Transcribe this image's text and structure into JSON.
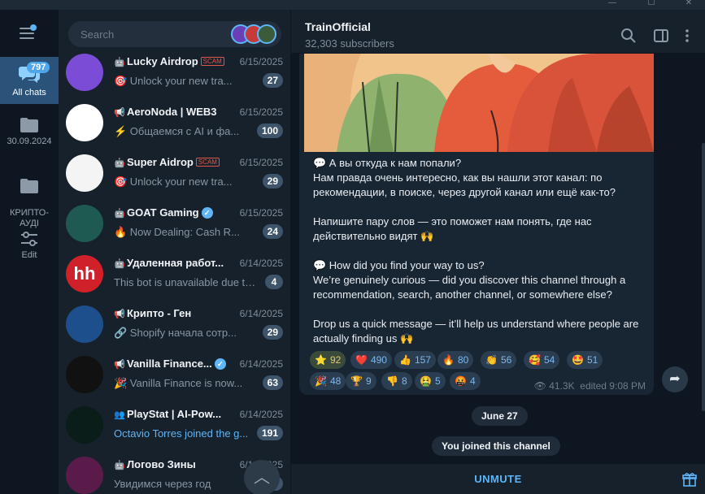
{
  "window": {
    "controls": [
      "—",
      "☐",
      "✕"
    ]
  },
  "folders": {
    "items": [
      {
        "label": "All chats",
        "badge": "797",
        "icon": "chat-bubbles-icon"
      },
      {
        "label": "30.09.2024",
        "icon": "folder-icon"
      },
      {
        "label": "КРИПТО-\nАУДІ",
        "icon": "folder-icon"
      },
      {
        "label": "Edit",
        "icon": "sliders-icon"
      }
    ]
  },
  "search": {
    "placeholder": "Search"
  },
  "chats": [
    {
      "name": "Lucky Airdrop",
      "scam": "SCAM",
      "date": "6/15/2025",
      "preview": "🎯 Unlock your new tra...",
      "count": "27",
      "avatar_color": "#7b4cd6",
      "type": "bot"
    },
    {
      "name": "AeroNoda | WEB3",
      "date": "6/15/2025",
      "preview": "⚡ Общаемся с AI и фа...",
      "count": "100",
      "avatar_color": "#ffffff",
      "type": "channel"
    },
    {
      "name": "Super Aidrop",
      "scam": "SCAM",
      "date": "6/15/2025",
      "preview": "🎯 Unlock your new tra...",
      "count": "29",
      "avatar_color": "#f4f4f4",
      "type": "bot"
    },
    {
      "name": "GOAT Gaming",
      "verified": true,
      "date": "6/15/2025",
      "preview": "🔥 Now Dealing: Cash R...",
      "count": "24",
      "avatar_color": "#1e5a52",
      "type": "bot"
    },
    {
      "name": "Удаленная работ...",
      "date": "6/14/2025",
      "preview": "This bot is unavailable due to...",
      "count": "4",
      "avatar_color": "#d0202a",
      "avatar_text": "hh",
      "type": "bot"
    },
    {
      "name": "Крипто - Ген",
      "date": "6/14/2025",
      "preview": "🔗 Shopify начала сотр...",
      "count": "29",
      "avatar_color": "#1d4f8c",
      "type": "channel"
    },
    {
      "name": "Vanilla Finance...",
      "verified": true,
      "date": "6/14/2025",
      "preview": "🎉 Vanilla Finance is now...",
      "count": "63",
      "avatar_color": "#111111",
      "type": "channel"
    },
    {
      "name": "PlayStat | AI-Pow...",
      "date": "6/14/2025",
      "preview": "Octavio Torres joined the g...",
      "count": "191",
      "avatar_color": "#0b1d18",
      "type": "group",
      "preview_blue": true
    },
    {
      "name": "Логово Зины",
      "date": "6/14/2025",
      "preview": "Увидимся через год",
      "count": "3",
      "avatar_color": "#5a1a4a",
      "type": "bot"
    }
  ],
  "channel": {
    "title": "TrainOfficial",
    "subtitle": "32,303 subscribers",
    "message": "💬 А вы откуда к нам попали?\nНам правда очень интересно, как вы нашли этот канал: по рекомендации, в поиске, через другой канал или ещё как-то?\n\nНапишите пару слов — это поможет нам понять, где нас действительно видят 🙌\n\n💬 How did you find your way to us?\nWe’re genuinely curious — did you discover this channel through a recommendation, search, another channel, or somewhere else?\n\nDrop us a quick message — it’ll help us understand where people are actually finding us 🙌",
    "reactions": [
      {
        "emoji": "⭐",
        "count": "92",
        "selected": true
      },
      {
        "emoji": "❤️",
        "count": "490"
      },
      {
        "emoji": "👍",
        "count": "157"
      },
      {
        "emoji": "🔥",
        "count": "80"
      },
      {
        "emoji": "👏",
        "count": "56"
      },
      {
        "emoji": "🥰",
        "count": "54"
      },
      {
        "emoji": "🤩",
        "count": "51"
      },
      {
        "emoji": "🎉",
        "count": "48"
      },
      {
        "emoji": "🏆",
        "count": "9"
      },
      {
        "emoji": "👎",
        "count": "8"
      },
      {
        "emoji": "🤮",
        "count": "5"
      },
      {
        "emoji": "🤬",
        "count": "4"
      }
    ],
    "views": "41.3K",
    "edited": "edited 9:08 PM",
    "date_pill": "June 27",
    "service": "You joined this channel",
    "unmute": "UNMUTE"
  }
}
